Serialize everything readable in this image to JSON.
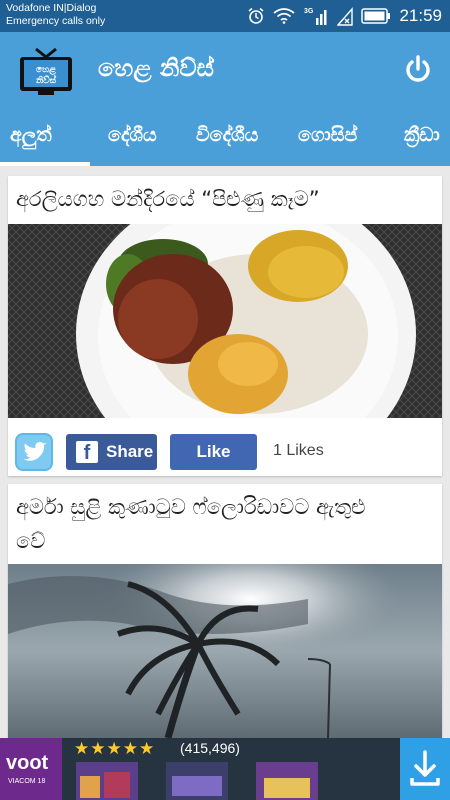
{
  "status": {
    "carrier": "Vodafone IN|Dialog",
    "emergency": "Emergency calls only",
    "time": "21:59",
    "network": "3G"
  },
  "app": {
    "title": "හෙළ නිව්ස්",
    "logo_text_1": "හෙළ",
    "logo_text_2": "නිව්ස්"
  },
  "tabs": [
    {
      "label": "අලුත්"
    },
    {
      "label": "දේශීය"
    },
    {
      "label": "විදේශීය"
    },
    {
      "label": "ගොසිප්"
    },
    {
      "label": "ක්‍රීඩා"
    }
  ],
  "articles": [
    {
      "title": "අරලියගහ මන්දිරයේ “පිළුණු කෑම”",
      "share_label": "Share",
      "like_label": "Like",
      "likes": "1 Likes"
    },
    {
      "title_line1": "අර්මා සුළි කුණාටුව ෆ්ලොරිඩාවට ඇතුළු",
      "title_line2": "වේ"
    }
  ],
  "ad": {
    "brand": "voot",
    "brand_sub": "VIACOM 18",
    "stars": "★★★★★",
    "rating_count": "(415,496)"
  },
  "colors": {
    "status_bar": "#1f5f93",
    "app_bar": "#4a9fd8",
    "facebook": "#3b5a9a",
    "ad_blue": "#1b9ef2"
  }
}
